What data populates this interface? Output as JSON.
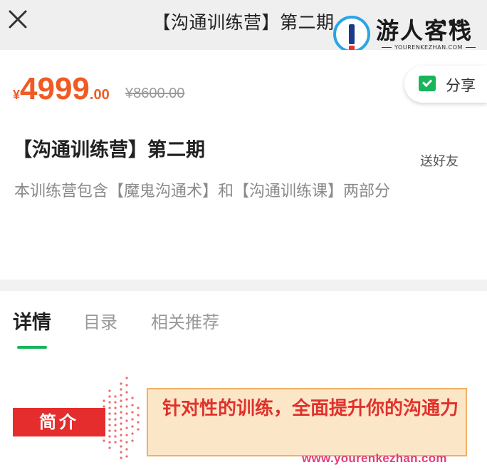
{
  "header": {
    "title": "【沟通训练营】第二期",
    "more": "•••"
  },
  "watermark": {
    "name": "游人客栈",
    "sub": "YOURENKEZHAN.COM",
    "url": "www.yourenkezhan.com"
  },
  "price": {
    "currency": "¥",
    "integer": "4999",
    "decimal": ".00",
    "original": "¥8600.00"
  },
  "course": {
    "title": "【沟通训练营】第二期",
    "description": "本训练营包含【魔鬼沟通术】和【沟通训练课】两部分"
  },
  "share": {
    "label": "分享",
    "sub": "送好友"
  },
  "tabs": [
    {
      "label": "详情",
      "active": true
    },
    {
      "label": "目录",
      "active": false
    },
    {
      "label": "相关推荐",
      "active": false
    }
  ],
  "intro": {
    "tag": "简介",
    "slogan": "针对性的训练，全面提升你的沟通力"
  },
  "colors": {
    "price": "#f05b23",
    "accent_green": "#18b55a",
    "tag_red": "#e52d2d",
    "slogan_bg": "#fce6c8"
  },
  "icons": [
    "close-icon",
    "share-icon",
    "more-icon"
  ]
}
